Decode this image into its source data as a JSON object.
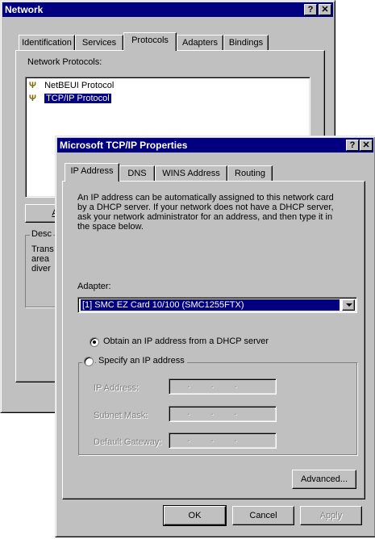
{
  "network_window": {
    "title": "Network",
    "help_btn": "?",
    "close_btn": "✕",
    "tabs": [
      "Identification",
      "Services",
      "Protocols",
      "Adapters",
      "Bindings"
    ],
    "list_label": "Network Protocols:",
    "protocols": [
      "NetBEUI Protocol",
      "TCP/IP Protocol"
    ],
    "add_btn_partial": "A",
    "desc_group_partial": "Desc",
    "desc_lines_partial": [
      "Trans",
      "area",
      "diver"
    ]
  },
  "tcpip_window": {
    "title": "Microsoft TCP/IP Properties",
    "help_btn": "?",
    "close_btn": "✕",
    "tabs": [
      "IP Address",
      "DNS",
      "WINS Address",
      "Routing"
    ],
    "description": [
      "An IP address can be automatically assigned to this network card",
      "by a DHCP server.  If your network does not have a DHCP server,",
      "ask your network administrator for an address, and then type it in",
      "the space below."
    ],
    "adapter_label": "Adapter:",
    "adapter_value": "[1] SMC EZ Card 10/100 (SMC1255FTX)",
    "radio_obtain": "Obtain an IP address from a DHCP server",
    "radio_specify": "Specify an IP address",
    "ip_label": "IP Address:",
    "mask_label": "Subnet Mask:",
    "gateway_label": "Default Gateway:",
    "advanced_btn": "Advanced...",
    "ok_btn": "OK",
    "cancel_btn": "Cancel",
    "apply_btn": "Apply",
    "selected_radio": "obtain"
  }
}
